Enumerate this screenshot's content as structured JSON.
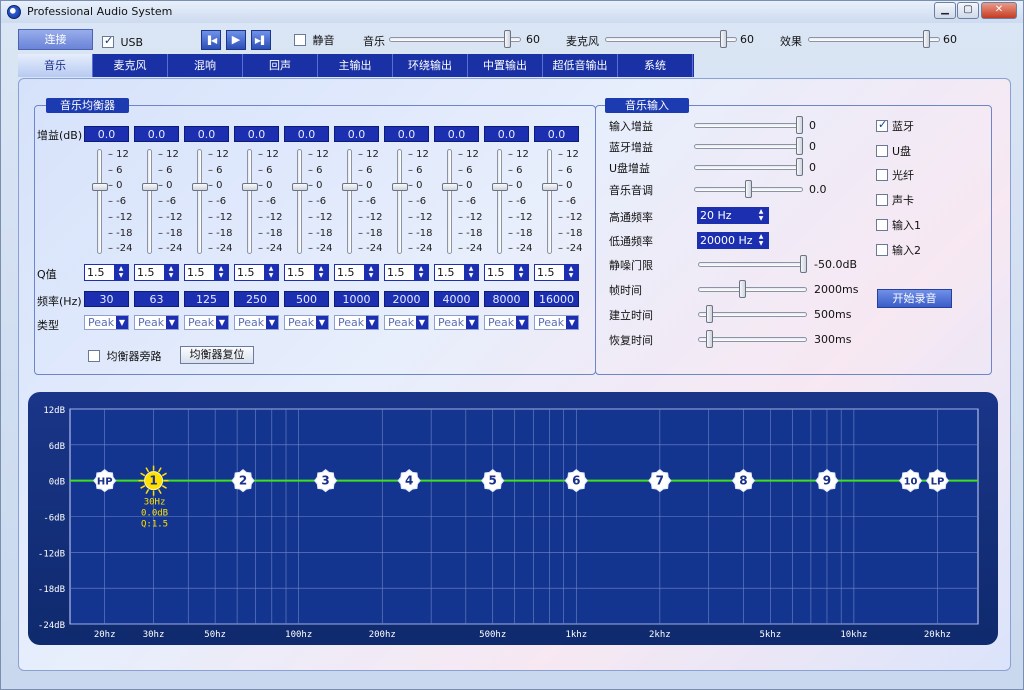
{
  "window": {
    "title": "Professional Audio System",
    "controls": {
      "minimize": "▁",
      "maximize": "▢",
      "close": "✕"
    }
  },
  "toolbar": {
    "connect_label": "连接",
    "usb_label": "USB",
    "usb_checked": true,
    "mute_label": "静音",
    "mute_checked": false,
    "music_label": "音乐",
    "music_value": "60",
    "music_level": 0.92,
    "mic_label": "麦克风",
    "mic_value": "60",
    "mic_level": 0.92,
    "effect_label": "效果",
    "effect_value": "60",
    "effect_level": 0.92,
    "prev_icon": "▐◀",
    "play_icon": "▶",
    "next_icon": "▶▌"
  },
  "tabs": [
    "音乐",
    "麦克风",
    "混响",
    "回声",
    "主输出",
    "环绕输出",
    "中置输出",
    "超低音输出",
    "系统"
  ],
  "active_tab": 0,
  "eq": {
    "title": "音乐均衡器",
    "gain_label": "增益(dB)",
    "q_label": "Q值",
    "freq_label": "频率(Hz)",
    "type_label": "类型",
    "scale": [
      "12",
      "6",
      "0",
      "-6",
      "-12",
      "-18",
      "-24"
    ],
    "bands": [
      {
        "gain": "0.0",
        "q": "1.5",
        "freq": "30",
        "type": "Peak"
      },
      {
        "gain": "0.0",
        "q": "1.5",
        "freq": "63",
        "type": "Peak"
      },
      {
        "gain": "0.0",
        "q": "1.5",
        "freq": "125",
        "type": "Peak"
      },
      {
        "gain": "0.0",
        "q": "1.5",
        "freq": "250",
        "type": "Peak"
      },
      {
        "gain": "0.0",
        "q": "1.5",
        "freq": "500",
        "type": "Peak"
      },
      {
        "gain": "0.0",
        "q": "1.5",
        "freq": "1000",
        "type": "Peak"
      },
      {
        "gain": "0.0",
        "q": "1.5",
        "freq": "2000",
        "type": "Peak"
      },
      {
        "gain": "0.0",
        "q": "1.5",
        "freq": "4000",
        "type": "Peak"
      },
      {
        "gain": "0.0",
        "q": "1.5",
        "freq": "8000",
        "type": "Peak"
      },
      {
        "gain": "0.0",
        "q": "1.5",
        "freq": "16000",
        "type": "Peak"
      }
    ],
    "bypass_label": "均衡器旁路",
    "bypass_checked": false,
    "reset_label": "均衡器复位"
  },
  "input": {
    "title": "音乐输入",
    "input_gain_label": "输入增益",
    "input_gain_value": "0",
    "input_gain_level": 1.0,
    "bt_gain_label": "蓝牙增益",
    "bt_gain_value": "0",
    "bt_gain_level": 1.0,
    "usb_gain_label": "U盘增益",
    "usb_gain_value": "0",
    "usb_gain_level": 1.0,
    "tone_label": "音乐音调",
    "tone_value": "0.0",
    "tone_level": 0.5,
    "hp_label": "高通频率",
    "hp_value": "20 Hz",
    "lp_label": "低通频率",
    "lp_value": "20000 Hz",
    "noise_label": "静噪门限",
    "noise_value": "-50.0dB",
    "noise_level": 1.0,
    "hold_label": "帧时间",
    "hold_value": "2000ms",
    "hold_level": 0.4,
    "attack_label": "建立时间",
    "attack_value": "500ms",
    "attack_level": 0.08,
    "release_label": "恢复时间",
    "release_value": "300ms",
    "release_level": 0.08,
    "sources": [
      {
        "label": "蓝牙",
        "checked": true
      },
      {
        "label": "U盘",
        "checked": false
      },
      {
        "label": "光纤",
        "checked": false
      },
      {
        "label": "声卡",
        "checked": false
      },
      {
        "label": "输入1",
        "checked": false
      },
      {
        "label": "输入2",
        "checked": false
      }
    ],
    "record_label": "开始录音"
  },
  "chart_data": {
    "type": "line",
    "x_scale": "log",
    "xlim": [
      15,
      28000
    ],
    "ylim": [
      -24,
      12
    ],
    "y_ticks": [
      "12dB",
      "6dB",
      "0dB",
      "-6dB",
      "-12dB",
      "-18dB",
      "-24dB"
    ],
    "y_tick_values": [
      12,
      6,
      0,
      -6,
      -12,
      -18,
      -24
    ],
    "x_ticks": [
      "20hz",
      "30hz",
      "50hz",
      "100hz",
      "200hz",
      "500hz",
      "1khz",
      "2khz",
      "5khz",
      "10khz",
      "20khz"
    ],
    "x_tick_values": [
      20,
      30,
      50,
      100,
      200,
      500,
      1000,
      2000,
      5000,
      10000,
      20000
    ],
    "curve": {
      "color": "#3ee01e",
      "points": [
        [
          15,
          0
        ],
        [
          28000,
          0
        ]
      ]
    },
    "markers": [
      {
        "label": "HP",
        "freq": 20,
        "gain": 0
      },
      {
        "label": "1",
        "freq": 30,
        "gain": 0,
        "selected": true
      },
      {
        "label": "2",
        "freq": 63,
        "gain": 0
      },
      {
        "label": "3",
        "freq": 125,
        "gain": 0
      },
      {
        "label": "4",
        "freq": 250,
        "gain": 0
      },
      {
        "label": "5",
        "freq": 500,
        "gain": 0
      },
      {
        "label": "6",
        "freq": 1000,
        "gain": 0
      },
      {
        "label": "7",
        "freq": 2000,
        "gain": 0
      },
      {
        "label": "8",
        "freq": 4000,
        "gain": 0
      },
      {
        "label": "9",
        "freq": 8000,
        "gain": 0
      },
      {
        "label": "10",
        "freq": 16000,
        "gain": 0
      },
      {
        "label": "LP",
        "freq": 20000,
        "gain": 0
      }
    ],
    "selected_info": [
      "30Hz",
      "0.0dB",
      "Q:1.5"
    ],
    "selected_color": "#ffe000"
  }
}
